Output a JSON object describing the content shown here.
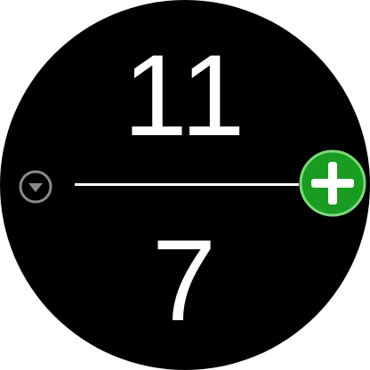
{
  "counter": {
    "top_value": "11",
    "bottom_value": "7"
  },
  "controls": {
    "decrease_icon": "chevron-down-circle-icon",
    "increase_icon": "plus-circle-icon"
  },
  "colors": {
    "background": "#000000",
    "text": "#ffffff",
    "accent_green": "#1a9b22",
    "accent_green_border": "#7dd87a",
    "muted_icon": "#8a8a8a"
  }
}
